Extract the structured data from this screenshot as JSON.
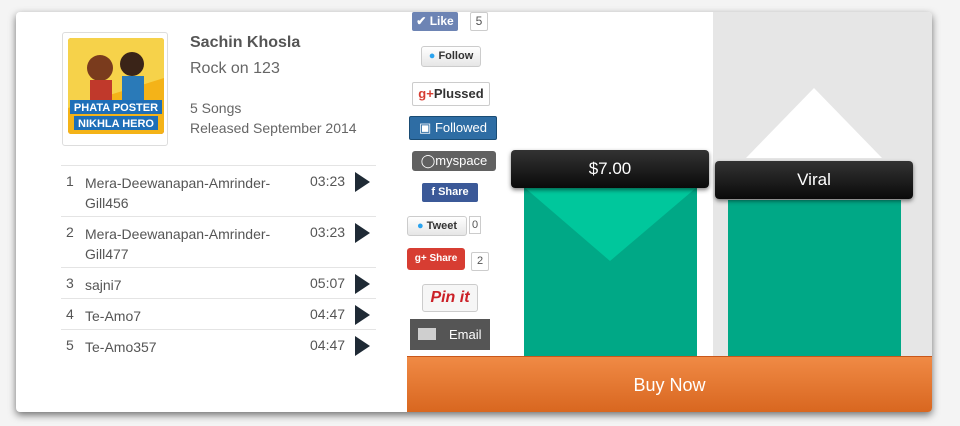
{
  "album": {
    "artist": "Sachin Khosla",
    "title": "Rock on 123",
    "song_count": "5 Songs",
    "released": "Released September 2014",
    "cover_text": "PHATA POSTER NIKHLA HERO"
  },
  "tracks": [
    {
      "num": "1",
      "title": "Mera-Deewanapan-Amrinder-Gill456",
      "duration": "03:23"
    },
    {
      "num": "2",
      "title": "Mera-Deewanapan-Amrinder-Gill477",
      "duration": "03:23"
    },
    {
      "num": "3",
      "title": "sajni7",
      "duration": "05:07"
    },
    {
      "num": "4",
      "title": "Te-Amo7",
      "duration": "04:47"
    },
    {
      "num": "5",
      "title": "Te-Amo357",
      "duration": "04:47"
    }
  ],
  "social": {
    "like_label": "Like",
    "like_count": "5",
    "follow_label": "Follow",
    "plussed_label": "Plussed",
    "followed_label": "Followed",
    "myspace_label": "myspace",
    "fb_share_label": "Share",
    "tweet_label": "Tweet",
    "tweet_count": "0",
    "gplus_share_label": "Share",
    "gplus_share_count": "2",
    "pinit_label": "Pin it",
    "email_label": "Email"
  },
  "pricing": {
    "price": "$7.00",
    "viral": "Viral",
    "buy_label": "Buy Now"
  },
  "colors": {
    "accent_green": "#00a886",
    "buy_orange": "#e7762f",
    "facebook_blue": "#3b5998"
  }
}
